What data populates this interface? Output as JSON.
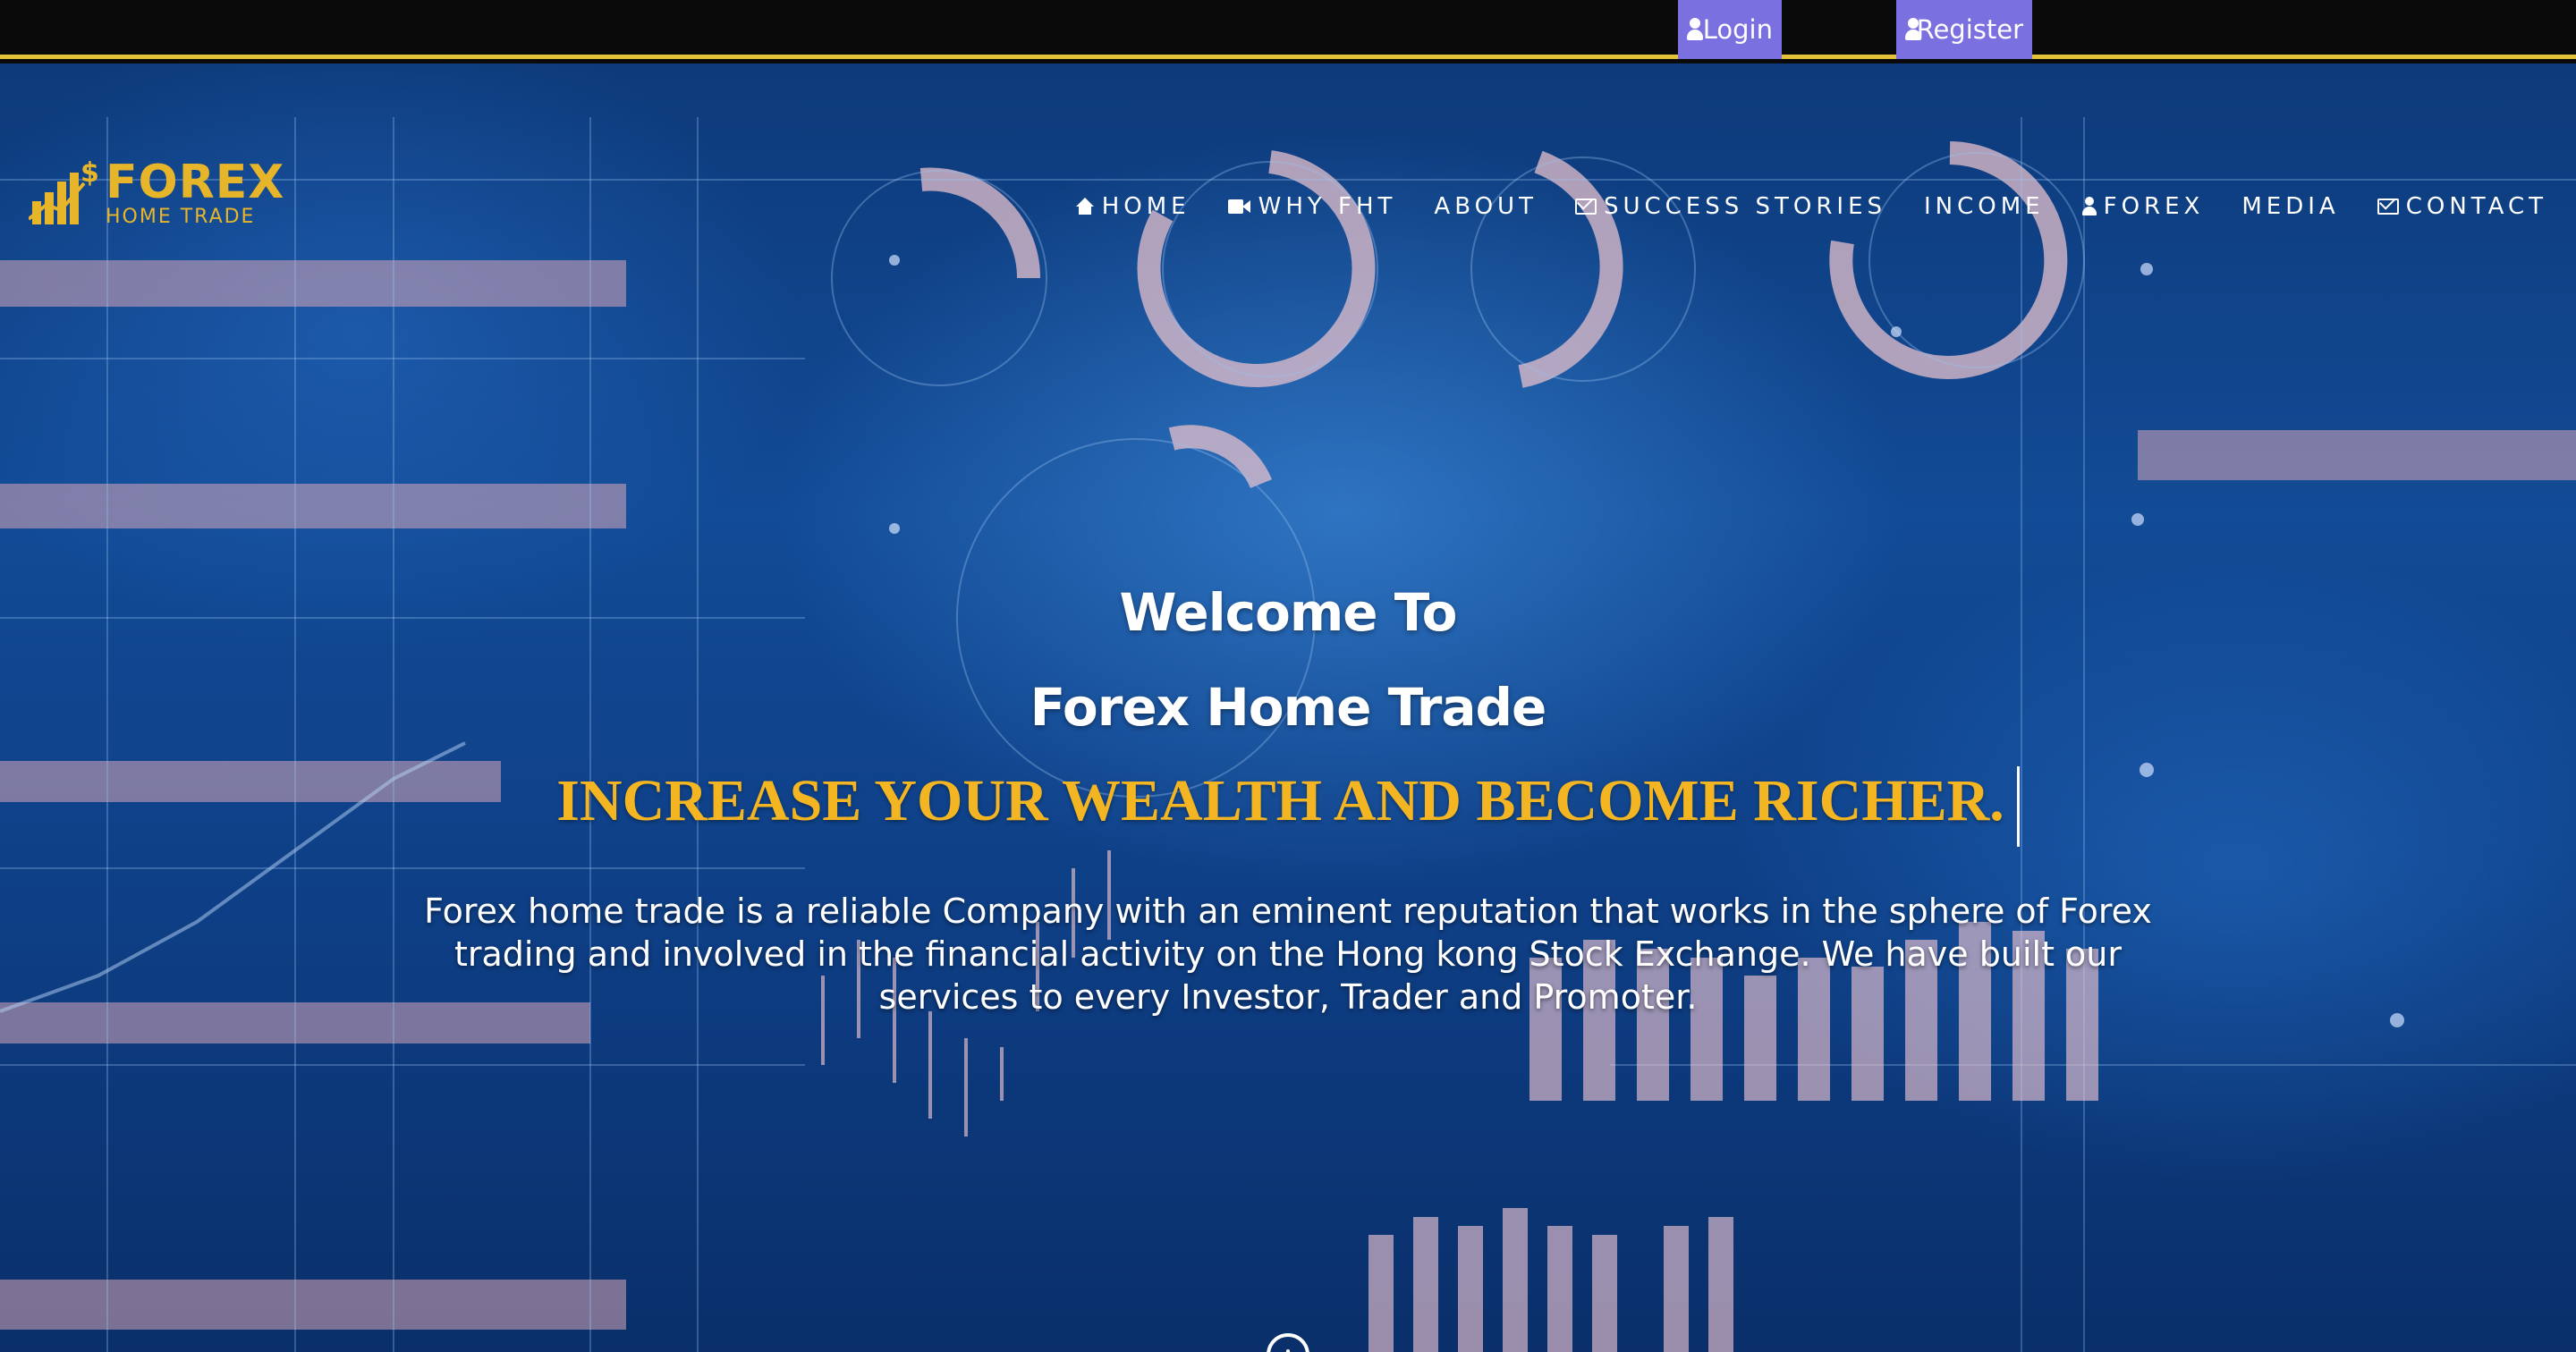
{
  "topbar": {
    "login_label": "Login",
    "register_label": "Register",
    "accent_color": "#e3c23a",
    "button_color": "#7b70e0"
  },
  "brand": {
    "name": "FOREX",
    "subtitle": "HOME TRADE",
    "color": "#e6b52a"
  },
  "nav": {
    "items": [
      {
        "label": "HOME",
        "icon": "home-icon"
      },
      {
        "label": "WHY FHT",
        "icon": "video-camera-icon"
      },
      {
        "label": "ABOUT",
        "icon": ""
      },
      {
        "label": "SUCCESS STORIES",
        "icon": "envelope-icon"
      },
      {
        "label": "INCOME",
        "icon": ""
      },
      {
        "label": "FOREX",
        "icon": "user-icon"
      },
      {
        "label": "MEDIA",
        "icon": ""
      },
      {
        "label": "CONTACT",
        "icon": "envelope-icon"
      }
    ]
  },
  "hero": {
    "welcome_line1": "Welcome To",
    "welcome_line2": "Forex Home Trade",
    "tagline": "INCREASE YOUR WEALTH AND BECOME RICHER.",
    "tagline_color": "#f3b522",
    "intro": "Forex home trade is a reliable Company with an eminent reputation that works in the sphere of Forex trading and involved in the financial activity on the Hong kong Stock Exchange. We have built our services to every Investor, Trader and Promoter."
  }
}
